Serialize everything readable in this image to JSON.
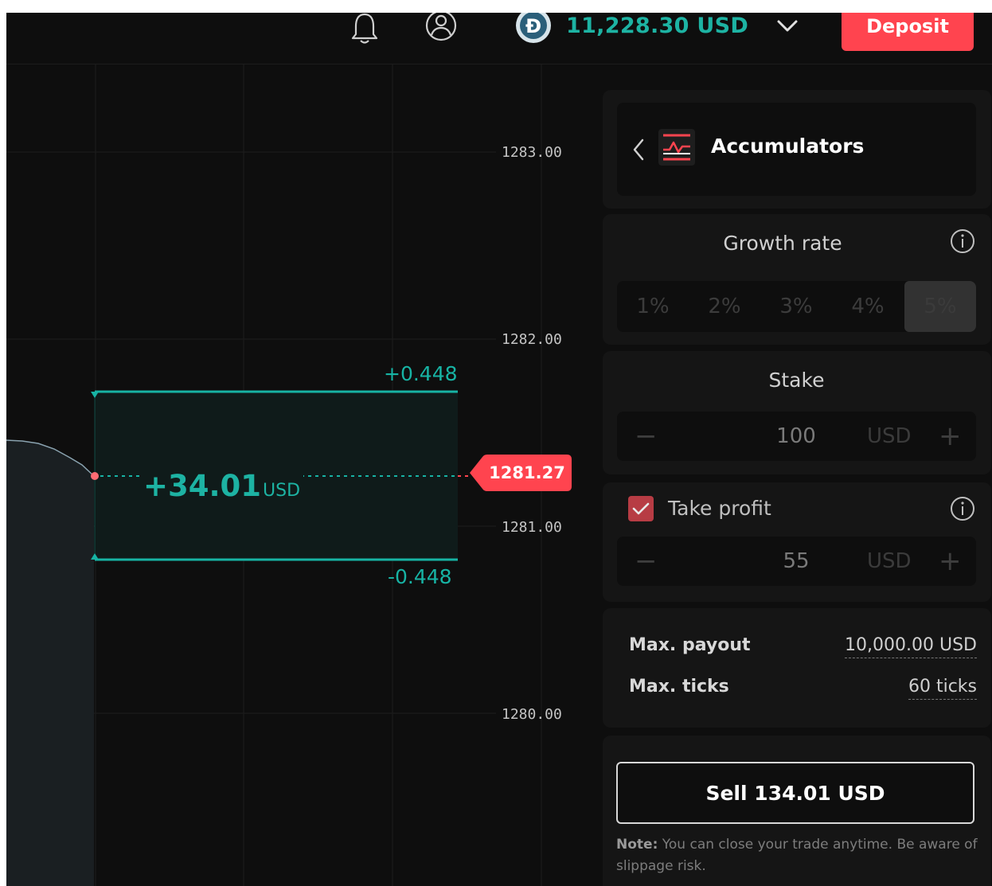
{
  "header": {
    "balance": "11,228.30 USD",
    "deposit_label": "Deposit",
    "icons": [
      "bell-icon",
      "account-icon",
      "currency-coin-icon",
      "chevron-down-icon"
    ]
  },
  "chart": {
    "y_ticks": [
      "1283.00",
      "1282.00",
      "1281.00",
      "1280.00"
    ],
    "barrier_high": "+0.448",
    "barrier_low": "-0.448",
    "pnl_value": "+34.01",
    "pnl_unit": "USD",
    "current_spot": "1281.27",
    "colors": {
      "accent": "#1db3a3",
      "loss": "#ff444f",
      "background": "#0e0e0e"
    }
  },
  "panel": {
    "trade_type": "Accumulators",
    "growth_rate": {
      "label": "Growth rate",
      "options": [
        "1%",
        "2%",
        "3%",
        "4%",
        "5%"
      ],
      "selected": "5%"
    },
    "stake": {
      "label": "Stake",
      "value": "100",
      "unit": "USD",
      "minus": "−",
      "plus": "+"
    },
    "take_profit": {
      "label": "Take profit",
      "checked": true,
      "value": "55",
      "unit": "USD",
      "minus": "−",
      "plus": "+"
    },
    "max_payout": {
      "label": "Max. payout",
      "value": "10,000.00 USD"
    },
    "max_ticks": {
      "label": "Max. ticks",
      "value": "60 ticks"
    },
    "sell_label": "Sell",
    "sell_amount": "134.01 USD",
    "note_label": "Note:",
    "note_text": "You can close your trade anytime. Be aware of slippage risk."
  }
}
